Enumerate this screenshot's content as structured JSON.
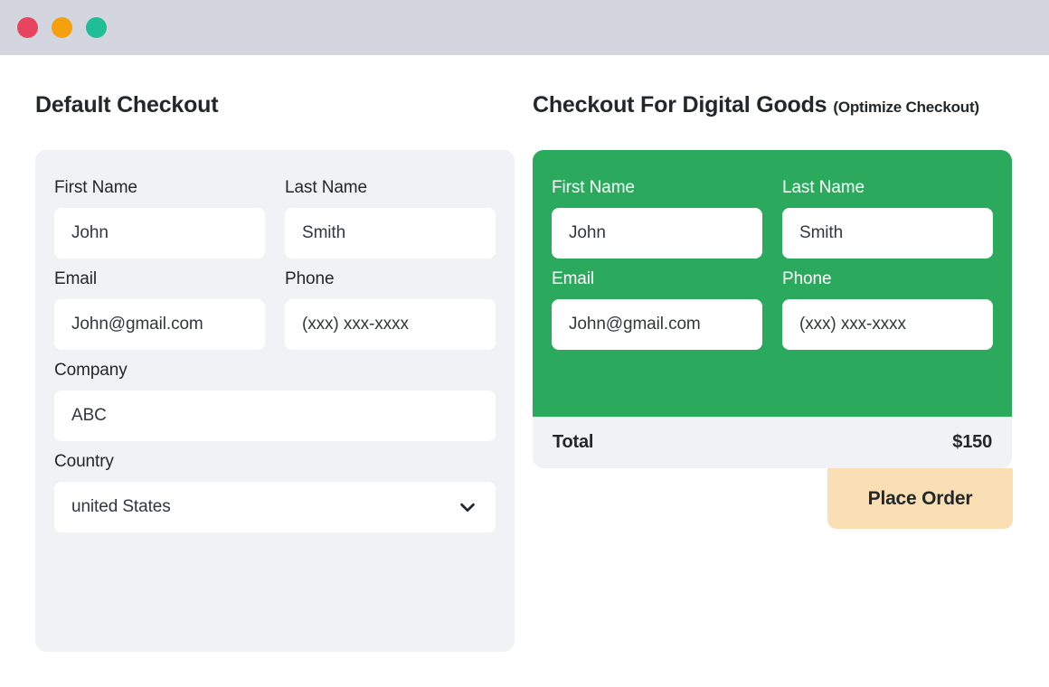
{
  "window": {
    "traffic_lights": [
      {
        "name": "close",
        "color": "#e8445f"
      },
      {
        "name": "minimize",
        "color": "#f5a00d"
      },
      {
        "name": "maximize",
        "color": "#1fbe96"
      }
    ]
  },
  "left_panel": {
    "title": "Default Checkout",
    "fields": {
      "first_name": {
        "label": "First Name",
        "value": "John"
      },
      "last_name": {
        "label": "Last Name",
        "value": "Smith"
      },
      "email": {
        "label": "Email",
        "value": "John@gmail.com"
      },
      "phone": {
        "label": "Phone",
        "value": "(xxx) xxx-xxxx"
      },
      "company": {
        "label": "Company",
        "value": "ABC"
      },
      "country": {
        "label": "Country",
        "value": "united States",
        "icon": "chevron-down-icon"
      }
    }
  },
  "right_panel": {
    "title": "Checkout For Digital Goods",
    "title_note": "(Optimize Checkout)",
    "accent_color": "#2baa5e",
    "fields": {
      "first_name": {
        "label": "First Name",
        "value": "John"
      },
      "last_name": {
        "label": "Last Name",
        "value": "Smith"
      },
      "email": {
        "label": "Email",
        "value": "John@gmail.com"
      },
      "phone": {
        "label": "Phone",
        "value": "(xxx) xxx-xxxx"
      }
    },
    "summary": {
      "total_label": "Total",
      "total_value": "$150"
    },
    "place_order_label": "Place Order",
    "place_order_color": "#fbdfb4"
  }
}
